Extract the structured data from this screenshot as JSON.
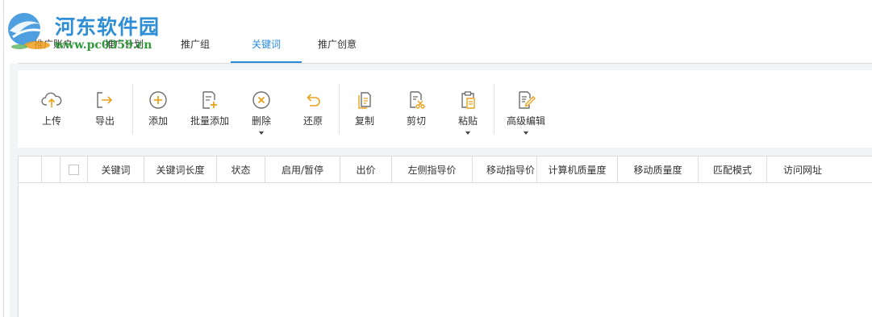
{
  "watermark": {
    "title": "河东软件园",
    "url": "www.pc0359.cn"
  },
  "tabs": [
    {
      "label": "推广账户",
      "active": false
    },
    {
      "label": "推广计划",
      "active": false
    },
    {
      "label": "推广组",
      "active": false
    },
    {
      "label": "关键词",
      "active": true
    },
    {
      "label": "推广创意",
      "active": false
    }
  ],
  "toolbar": {
    "buttons": [
      {
        "label": "上传",
        "icon": "upload-cloud-icon"
      },
      {
        "label": "导出",
        "icon": "export-icon"
      },
      {
        "label": "添加",
        "icon": "add-circle-icon"
      },
      {
        "label": "批量添加",
        "icon": "batch-add-icon"
      },
      {
        "label": "删除",
        "icon": "delete-circle-icon",
        "dropdown": true
      },
      {
        "label": "还原",
        "icon": "undo-icon"
      },
      {
        "label": "复制",
        "icon": "copy-icon"
      },
      {
        "label": "剪切",
        "icon": "cut-icon"
      },
      {
        "label": "粘贴",
        "icon": "paste-icon",
        "dropdown": true
      },
      {
        "label": "高级编辑",
        "icon": "advanced-edit-icon",
        "dropdown": true
      }
    ]
  },
  "grid": {
    "columns": [
      "关键词",
      "关键词长度",
      "状态",
      "启用/暂停",
      "出价",
      "左侧指导价",
      "移动指导价",
      "计算机质量度",
      "移动质量度",
      "匹配模式",
      "访问网址"
    ],
    "rows": []
  },
  "colors": {
    "accent": "#2a8bde",
    "icon_orange": "#e8a21e",
    "icon_gray": "#6e6e6e",
    "logo_blue": "#2f8fd6",
    "logo_green": "#2f9a3a"
  }
}
